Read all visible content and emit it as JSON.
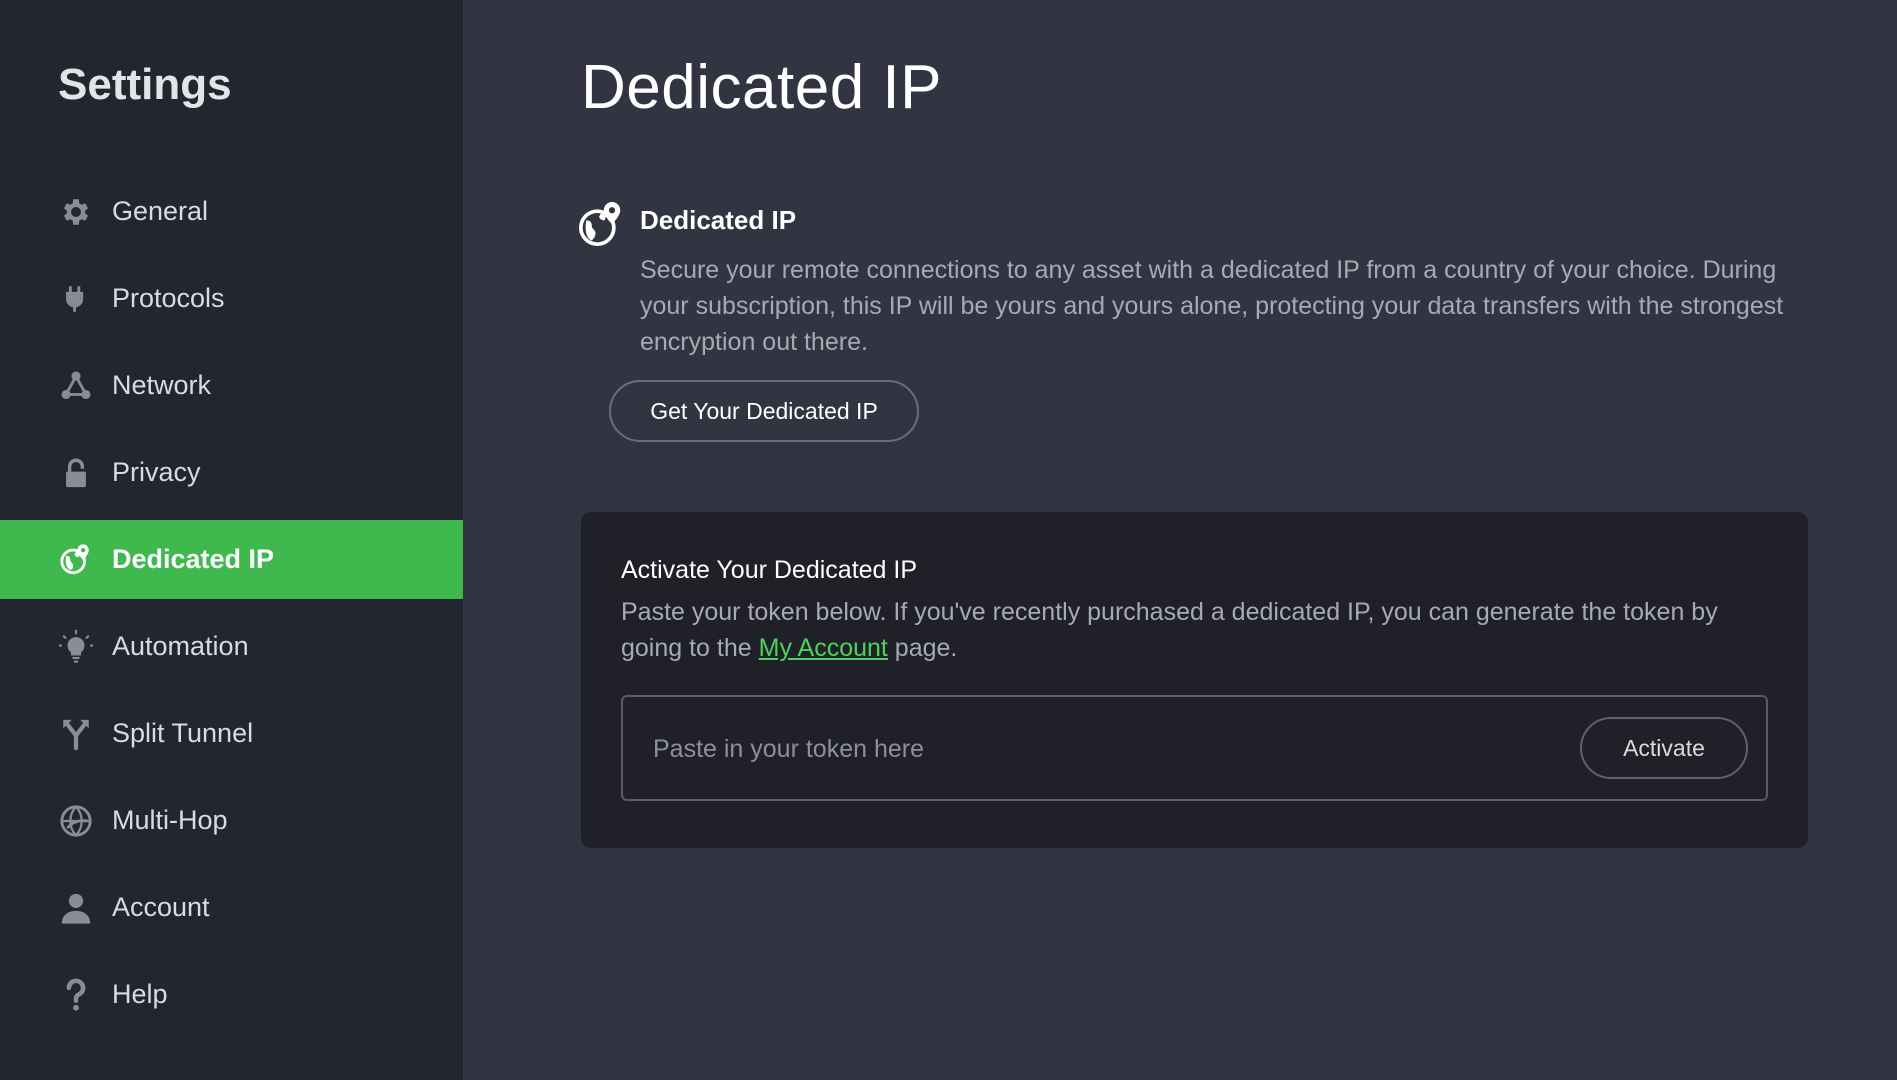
{
  "sidebar": {
    "title": "Settings",
    "items": [
      {
        "label": "General",
        "icon": "gear-icon"
      },
      {
        "label": "Protocols",
        "icon": "plug-icon"
      },
      {
        "label": "Network",
        "icon": "network-icon"
      },
      {
        "label": "Privacy",
        "icon": "lock-icon"
      },
      {
        "label": "Dedicated IP",
        "icon": "globe-pin-icon",
        "active": true
      },
      {
        "label": "Automation",
        "icon": "lightbulb-icon"
      },
      {
        "label": "Split Tunnel",
        "icon": "split-icon"
      },
      {
        "label": "Multi-Hop",
        "icon": "multihop-globe-icon"
      },
      {
        "label": "Account",
        "icon": "user-icon"
      },
      {
        "label": "Help",
        "icon": "question-icon"
      }
    ]
  },
  "main": {
    "title": "Dedicated IP",
    "section": {
      "icon": "globe-pin-icon",
      "title": "Dedicated IP",
      "description": "Secure your remote connections to any asset with a dedicated IP from a country of your choice. During your subscription, this IP will be yours and yours alone, protecting your data transfers with the strongest encryption out there.",
      "button_label": "Get Your Dedicated IP"
    },
    "activate": {
      "title": "Activate Your Dedicated IP",
      "description_before": "Paste your token below. If you've recently purchased a dedicated IP, you can generate the token by going to the ",
      "link_text": "My Account",
      "description_after": " page.",
      "input_value": "",
      "input_placeholder": "Paste in your token here",
      "button_label": "Activate"
    }
  },
  "colors": {
    "accent": "#3fb94d",
    "link": "#4cd35a",
    "sidebar_bg": "#24262f",
    "main_bg": "#323541",
    "card_bg": "#1f2028"
  }
}
